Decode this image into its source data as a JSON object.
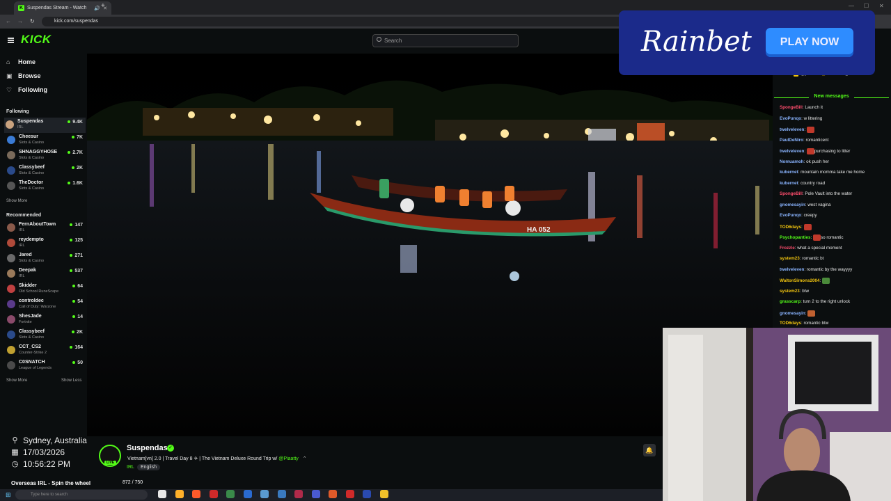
{
  "browser": {
    "tab_title": "Suspendas Stream - Watch",
    "url": "kick.com/suspendas"
  },
  "header": {
    "logo": "KICK",
    "search_placeholder": "Search"
  },
  "nav": {
    "home": "Home",
    "browse": "Browse",
    "following": "Following"
  },
  "following": {
    "title": "Following",
    "channels": [
      {
        "name": "Suspendas",
        "category": "IRL",
        "viewers": "9.4K",
        "color": "#c9a27e"
      },
      {
        "name": "Cheesur",
        "category": "Slots & Casino",
        "viewers": "7K",
        "color": "#3a7bd5"
      },
      {
        "name": "SHNAGGYHOSE",
        "category": "Slots & Casino",
        "viewers": "2.7K",
        "color": "#7a6a5a"
      },
      {
        "name": "Classybeef",
        "category": "Slots & Casino",
        "viewers": "2K",
        "color": "#2a4a8a"
      },
      {
        "name": "TheDoctor",
        "category": "Slots & Casino",
        "viewers": "1.6K",
        "color": "#555"
      }
    ],
    "show_more": "Show More"
  },
  "recommended": {
    "title": "Recommended",
    "channels": [
      {
        "name": "FernAboutTown",
        "category": "IRL",
        "viewers": "147",
        "color": "#8a5a4a"
      },
      {
        "name": "reydempto",
        "category": "IRL",
        "viewers": "125",
        "color": "#b04a3a"
      },
      {
        "name": "Jared",
        "category": "Slots & Casino",
        "viewers": "271",
        "color": "#6a6a6a"
      },
      {
        "name": "Deepak",
        "category": "IRL",
        "viewers": "537",
        "color": "#9a7a5a"
      },
      {
        "name": "Skidder",
        "category": "Old School RuneScape",
        "viewers": "64",
        "color": "#c04040"
      },
      {
        "name": "controldec",
        "category": "Call of Duty: Warzone",
        "viewers": "54",
        "color": "#5a3a8a"
      },
      {
        "name": "ShesJade",
        "category": "Fortnite",
        "viewers": "14",
        "color": "#8a4a6a"
      },
      {
        "name": "Classybeef",
        "category": "Slots & Casino",
        "viewers": "2K",
        "color": "#2a4a8a"
      },
      {
        "name": "CCT_CS2",
        "category": "Counter-Strike 2",
        "viewers": "164",
        "color": "#c0a030"
      },
      {
        "name": "C0SNATCH",
        "category": "League of Legends",
        "viewers": "50",
        "color": "#4a4a4a"
      }
    ],
    "show_more": "Show More",
    "show_less": "Show Less"
  },
  "overlay": {
    "location": "Sydney, Australia",
    "date": "17/03/2026",
    "time": "10:56:22 PM",
    "goal_label": "Overseas IRL - Spin the wheel",
    "goal_count": "872 / 750",
    "goal_progress": 1.0
  },
  "stream": {
    "streamer": "Suspendas",
    "title": "Vietnam[vn] 2.0 | Travel Day 8 ✈ | The Vietnam Deluxe Round Trip w/",
    "mention": "@Piaatty",
    "category": "IRL",
    "language": "English",
    "boat_label": "HA 052"
  },
  "ad": {
    "brand": "Rainbet",
    "cta": "PLAY NOW"
  },
  "chat": {
    "pinned_count": "16",
    "pinned_user": "mad_abstract",
    "pinned_val": "1",
    "new_messages": "New messages",
    "messages": [
      {
        "user": "SpongeBill",
        "text": "Launch it",
        "color": "#ff4d6d"
      },
      {
        "user": "EvoPunqo",
        "text": "w littering",
        "color": "#8ab4ff"
      },
      {
        "user": "twelveleven",
        "text": "",
        "color": "#8ab4ff",
        "emote": "#c0392b"
      },
      {
        "user": "PaulDeNiro",
        "text": "romanticent",
        "color": "#8ab4ff"
      },
      {
        "user": "twelveleven",
        "text": "purchasing to litter",
        "color": "#8ab4ff",
        "emote": "#c0392b"
      },
      {
        "user": "Nomuamoh",
        "text": "ok push her",
        "color": "#8ab4ff"
      },
      {
        "user": "kubernet",
        "text": "mountain momma take me home",
        "color": "#8ab4ff"
      },
      {
        "user": "kubernet",
        "text": "country road",
        "color": "#8ab4ff"
      },
      {
        "user": "SpongeBill",
        "text": "Pole Vault into the water",
        "color": "#ff4d6d"
      },
      {
        "user": "gnomesayin",
        "text": "west vagina",
        "color": "#8ab4ff"
      },
      {
        "user": "EvoPunqo",
        "text": "creepy",
        "color": "#8ab4ff"
      },
      {
        "user": "TOD6days",
        "text": "",
        "color": "#f1c40f",
        "emote": "#c0392b"
      },
      {
        "user": "Psychopanties",
        "text": "so romantic",
        "color": "#53fc18",
        "emote": "#c0392b"
      },
      {
        "user": "Frozzle",
        "text": "what a special moment",
        "color": "#ff4d6d"
      },
      {
        "user": "system23",
        "text": "romantic bt",
        "color": "#f1c40f"
      },
      {
        "user": "twelveleven",
        "text": "romantic by the wayyyy",
        "color": "#8ab4ff"
      },
      {
        "user": "WaltonSimons2004",
        "text": "",
        "color": "#f1c40f",
        "emote": "#4a8a3a"
      },
      {
        "user": "system23",
        "text": "btw",
        "color": "#f1c40f"
      },
      {
        "user": "grasscarp",
        "text": "turn 2 to the right unlock",
        "color": "#53fc18"
      },
      {
        "user": "gnomesayin",
        "text": "",
        "color": "#8ab4ff",
        "emote": "#c06030"
      },
      {
        "user": "TOD6days",
        "text": "romantic btw",
        "color": "#f1c40f"
      }
    ]
  },
  "taskbar": {
    "search_placeholder": "Type here to search"
  }
}
